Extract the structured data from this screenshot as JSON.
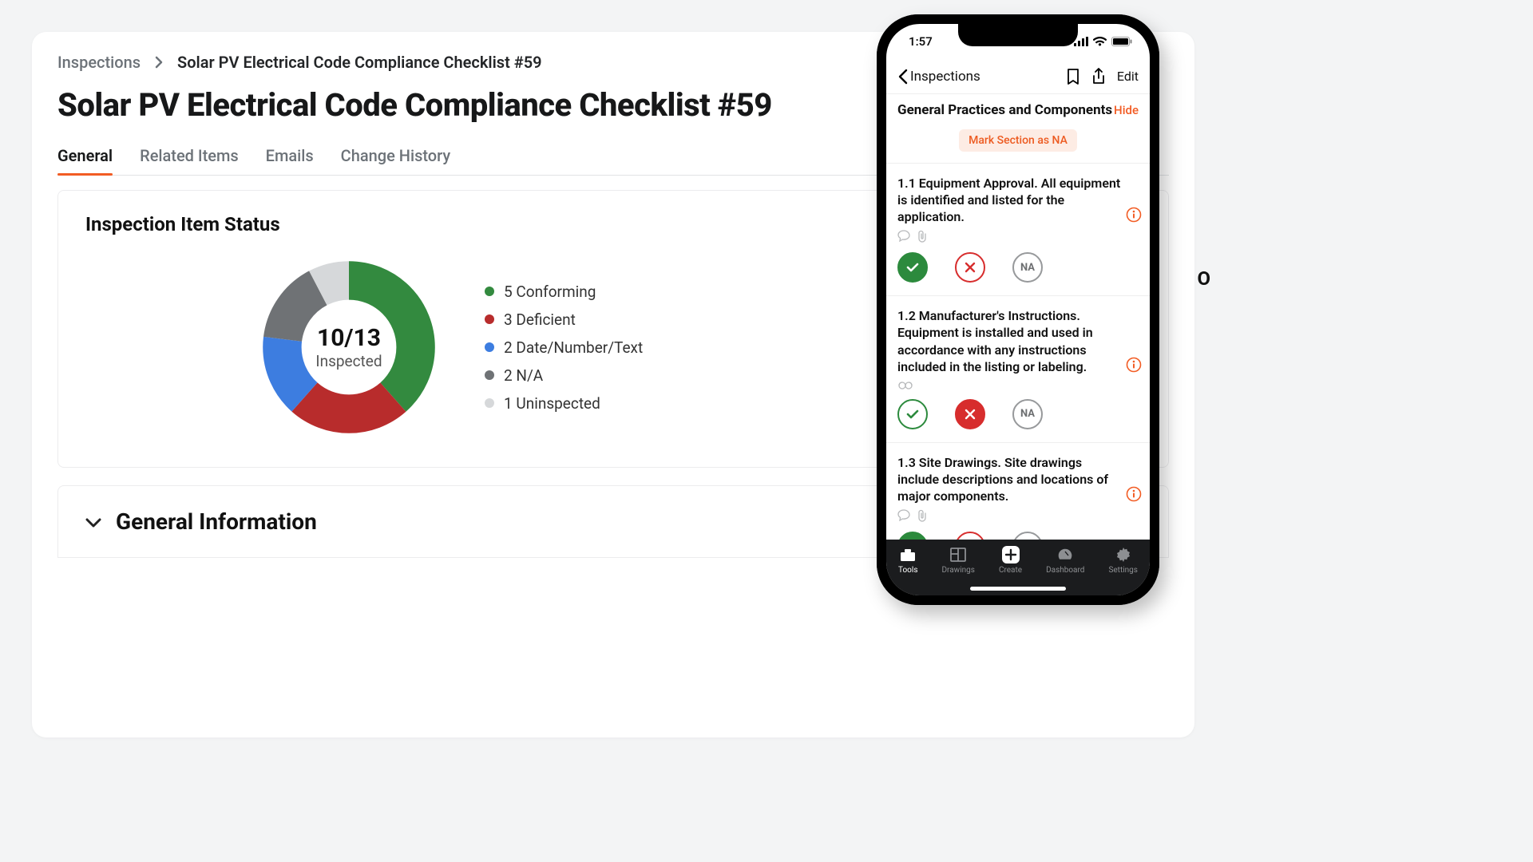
{
  "breadcrumb": {
    "root": "Inspections",
    "current": "Solar PV Electrical Code Compliance Checklist #59"
  },
  "page_title": "Solar PV Electrical Code Compliance Checklist #59",
  "tabs": [
    "General",
    "Related Items",
    "Emails",
    "Change History"
  ],
  "active_tab": 0,
  "status_card": {
    "title": "Inspection Item Status",
    "center_value": "10/13",
    "center_label": "Inspected",
    "legend": [
      {
        "count": 5,
        "label": "Conforming",
        "color": "#338a3f"
      },
      {
        "count": 3,
        "label": "Deficient",
        "color": "#b82c2c"
      },
      {
        "count": 2,
        "label": "Date/Number/Text",
        "color": "#3d7de0"
      },
      {
        "count": 2,
        "label": "N/A",
        "color": "#6f7275"
      },
      {
        "count": 1,
        "label": "Uninspected",
        "color": "#d6d8da"
      }
    ]
  },
  "chart_data": {
    "type": "pie",
    "title": "Inspection Item Status",
    "categories": [
      "Conforming",
      "Deficient",
      "Date/Number/Text",
      "N/A",
      "Uninspected"
    ],
    "values": [
      5,
      3,
      2,
      2,
      1
    ],
    "colors": [
      "#338a3f",
      "#b82c2c",
      "#3d7de0",
      "#6f7275",
      "#d6d8da"
    ],
    "center": {
      "value": "10/13",
      "label": "Inspected",
      "total": 13
    }
  },
  "overview_peek": "O",
  "general_info_title": "General Information",
  "phone": {
    "time": "1:57",
    "back_label": "Inspections",
    "edit_label": "Edit",
    "section_title": "General Practices and Components",
    "hide_label": "Hide",
    "mark_na_label": "Mark Section as NA",
    "na_label": "NA",
    "items": [
      {
        "text": "1.1 Equipment Approval. All equipment is identified and listed for the application.",
        "selected": "pass",
        "has_comment_icon": true,
        "has_attach_icon": true
      },
      {
        "text": "1.2 Manufacturer's Instructions. Equipment is installed and used in accordance with any instructions included in the listing or labeling.",
        "selected": "fail",
        "has_glasses_icon": true
      },
      {
        "text": "1.3 Site Drawings. Site drawings include descriptions and locations of major components.",
        "selected": "pass",
        "has_comment_icon": true,
        "has_attach_icon": true
      }
    ],
    "tabbar": [
      {
        "label": "Tools",
        "icon": "tools",
        "active": true
      },
      {
        "label": "Drawings",
        "icon": "drawings",
        "active": false
      },
      {
        "label": "Create",
        "icon": "create",
        "active": false
      },
      {
        "label": "Dashboard",
        "icon": "dashboard",
        "active": false
      },
      {
        "label": "Settings",
        "icon": "settings",
        "active": false
      }
    ]
  }
}
